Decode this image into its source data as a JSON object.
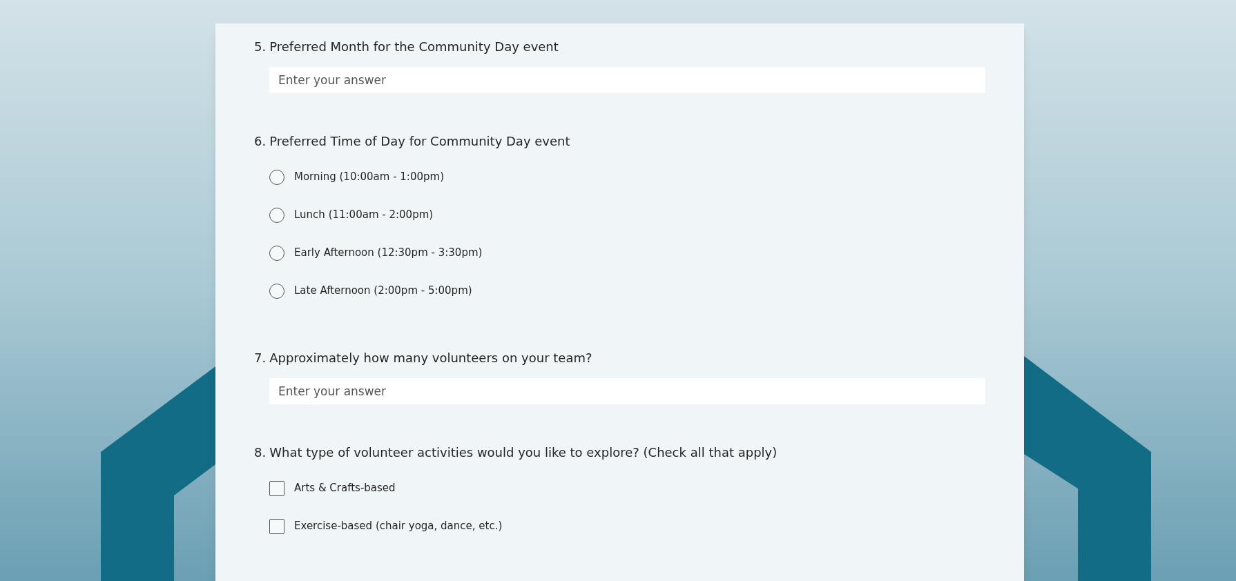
{
  "questions": [
    {
      "kind": "text",
      "number": "5.",
      "title": "Preferred Month for the Community Day event",
      "placeholder": "Enter your answer"
    },
    {
      "kind": "radio",
      "number": "6.",
      "title": "Preferred Time of Day for Community Day event",
      "options": [
        {
          "label": "Morning (10:00am - 1:00pm)",
          "selected": false
        },
        {
          "label": "Lunch (11:00am - 2:00pm)",
          "selected": false
        },
        {
          "label": "Early Afternoon (12:30pm - 3:30pm)",
          "selected": false
        },
        {
          "label": "Late Afternoon (2:00pm - 5:00pm)",
          "selected": false
        }
      ]
    },
    {
      "kind": "text",
      "number": "7.",
      "title": "Approximately how many volunteers on your team?",
      "placeholder": "Enter your answer"
    },
    {
      "kind": "checkbox",
      "number": "8.",
      "title": "What type of volunteer activities would you like to explore? (Check all that apply)",
      "options": [
        {
          "label": "Arts & Crafts-based",
          "checked": false
        },
        {
          "label": "Exercise-based (chair yoga, dance, etc.)",
          "checked": false
        }
      ]
    }
  ]
}
